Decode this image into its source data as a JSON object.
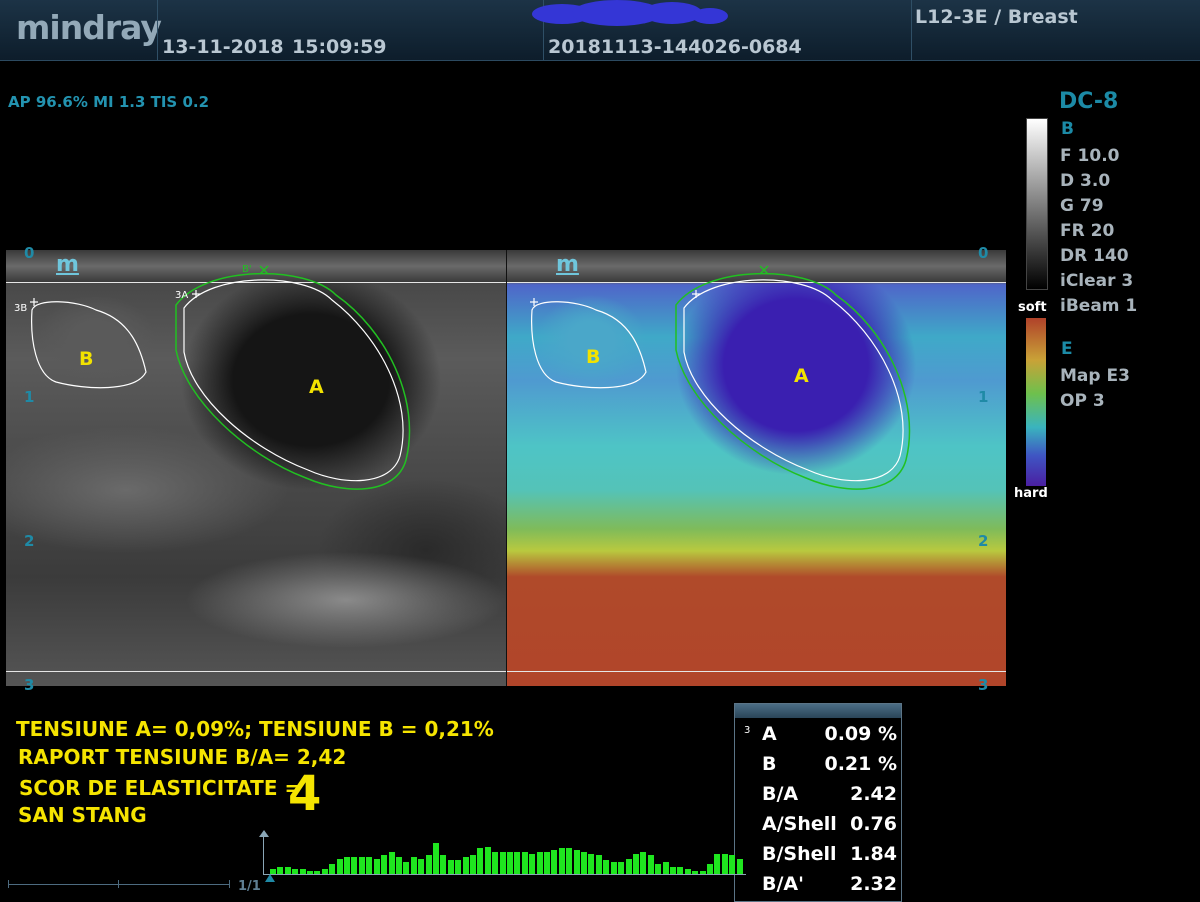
{
  "header": {
    "brand": "mindray",
    "date": "13-11-2018",
    "time": "15:09:59",
    "exam_id": "20181113-144026-0684",
    "probe_preset": "L12-3E / Breast"
  },
  "acoustic_output": "AP 96.6%  MI 1.3 TIS 0.2",
  "system_params": {
    "model": "DC-8",
    "mode_b": "B",
    "b_params": [
      "F 10.0",
      "D 3.0",
      "G 79",
      "FR 20",
      "DR 140",
      "iClear 3",
      "iBeam 1"
    ],
    "mode_e": "E",
    "e_params": [
      "Map E3",
      "OP 3"
    ]
  },
  "elasto_scale": {
    "top_label": "soft",
    "bottom_label": "hard"
  },
  "image": {
    "left_marker": "m",
    "right_marker": "m",
    "region_a": "A",
    "region_b": "B",
    "depth_ticks": [
      "0",
      "1",
      "2",
      "3"
    ],
    "roi_tag_b": "3B",
    "roi_tag_a": "3A",
    "roi_tag_shell": "B'"
  },
  "annotations": {
    "line1": "TENSIUNE A= 0,09%; TENSIUNE B = 0,21%",
    "line2": "RAPORT TENSIUNE B/A= 2,42",
    "line3": "SCOR DE ELASTICITATE =",
    "score": "4",
    "line4": "SAN STANG"
  },
  "results": {
    "index": "3",
    "rows": [
      {
        "label": "A",
        "value": "0.09 %"
      },
      {
        "label": "B",
        "value": "0.21 %"
      },
      {
        "label": "B/A",
        "value": "2.42"
      },
      {
        "label": "A/Shell",
        "value": "0.76"
      },
      {
        "label": "B/Shell",
        "value": "1.84"
      },
      {
        "label": "B/A'",
        "value": "2.32"
      }
    ]
  },
  "pressure_graph": {
    "levels": [
      0.15,
      0.2,
      0.2,
      0.15,
      0.15,
      0.1,
      0.1,
      0.15,
      0.3,
      0.45,
      0.5,
      0.5,
      0.5,
      0.5,
      0.45,
      0.55,
      0.65,
      0.5,
      0.35,
      0.5,
      0.45,
      0.55,
      0.9,
      0.55,
      0.4,
      0.4,
      0.5,
      0.55,
      0.75,
      0.8,
      0.65,
      0.65,
      0.65,
      0.65,
      0.65,
      0.6,
      0.65,
      0.65,
      0.7,
      0.75,
      0.75,
      0.7,
      0.65,
      0.6,
      0.55,
      0.4,
      0.35,
      0.35,
      0.45,
      0.6,
      0.65,
      0.55,
      0.3,
      0.35,
      0.2,
      0.2,
      0.15,
      0.1,
      0.1,
      0.3,
      0.6,
      0.6,
      0.55,
      0.45
    ]
  },
  "cine": {
    "page": "1/1",
    "marker": "1"
  }
}
